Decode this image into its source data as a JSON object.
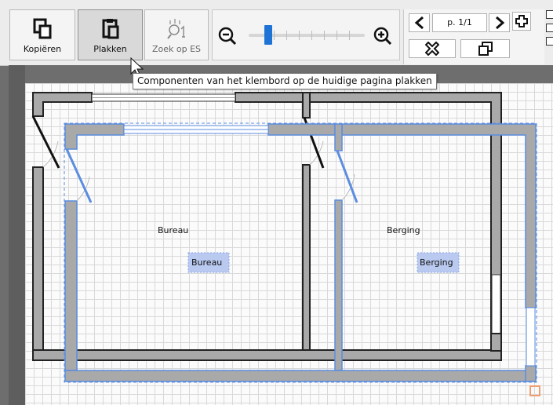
{
  "toolbar": {
    "copy_label": "Kopiëren",
    "paste_label": "Plakken",
    "search_label": "Zoek op ES"
  },
  "pager": {
    "page_value": "p. 1/1"
  },
  "tooltip": {
    "text": "Componenten van het klembord op de huidige pagina plakken"
  },
  "plan": {
    "rooms": [
      {
        "name": "Bureau",
        "tag": "Bureau"
      },
      {
        "name": "Berging",
        "tag": "Berging"
      }
    ]
  },
  "colors": {
    "wall_gray": "#a9a9a9",
    "wall_outline": "#222222",
    "selection_blue": "#5b8de0",
    "tag_fill": "#b9c9f0",
    "slider_blue": "#1f73d6"
  }
}
